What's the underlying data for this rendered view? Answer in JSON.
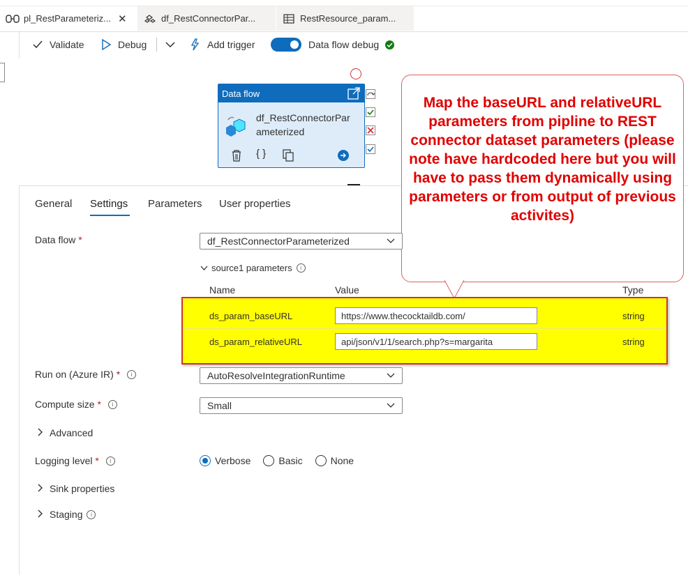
{
  "tabs": [
    {
      "label": "pl_RestParameteriz...",
      "icon": "pipeline-icon",
      "active": true,
      "close": "✕"
    },
    {
      "label": "df_RestConnectorPar...",
      "icon": "dataflow-icon",
      "active": false
    },
    {
      "label": "RestResource_param...",
      "icon": "dataset-table-icon",
      "active": false
    }
  ],
  "toolbar": {
    "validate": "Validate",
    "debug": "Debug",
    "add_trigger": "Add trigger",
    "data_flow_debug": "Data flow debug"
  },
  "activity": {
    "type_label": "Data flow",
    "name": "df_RestConnectorParameterized"
  },
  "callout": {
    "text": "Map the baseURL and relativeURL parameters from pipline to REST connector dataset parameters (please note have hardcoded here but you will have to pass them dynamically using parameters or from output of previous activites)"
  },
  "property_tabs": [
    "General",
    "Settings",
    "Parameters",
    "User properties"
  ],
  "settings": {
    "data_flow_label": "Data flow",
    "data_flow_value": "df_RestConnectorParameterized",
    "source_params_label": "source1 parameters",
    "col_name": "Name",
    "col_value": "Value",
    "col_type": "Type",
    "params": [
      {
        "name": "ds_param_baseURL",
        "value": "https://www.thecocktaildb.com/",
        "type": "string"
      },
      {
        "name": "ds_param_relativeURL",
        "value": "api/json/v1/1/search.php?s=margarita",
        "type": "string"
      }
    ],
    "run_on_label": "Run on (Azure IR)",
    "run_on_value": "AutoResolveIntegrationRuntime",
    "compute_label": "Compute size",
    "compute_value": "Small",
    "advanced_label": "Advanced",
    "logging_label": "Logging level",
    "logging_options": [
      "Verbose",
      "Basic",
      "None"
    ],
    "sink_label": "Sink properties",
    "staging_label": "Staging",
    "required_mark": "*"
  },
  "colors": {
    "accent": "#0f6cbd",
    "highlight": "#ffff00",
    "callout_text": "#e00000"
  }
}
